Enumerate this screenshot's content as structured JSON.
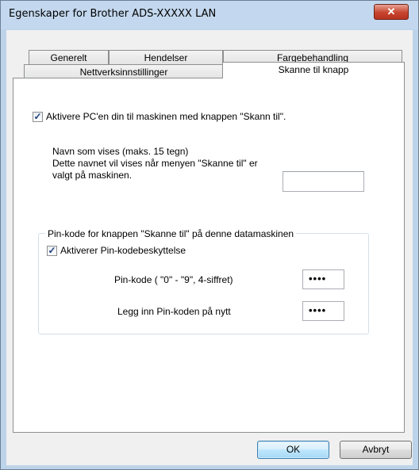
{
  "window": {
    "title": "Egenskaper for Brother ADS-XXXXX LAN",
    "close_glyph": "✕"
  },
  "tabs": {
    "row1": [
      "Generelt",
      "Hendelser",
      "Fargebehandling"
    ],
    "row2": [
      "Nettverksinnstillinger",
      "Skanne til knapp"
    ],
    "active": "Skanne til knapp"
  },
  "panel": {
    "enable_pc_label": "Aktivere PC'en din til maskinen med knappen \"Skann til\".",
    "enable_pc_checked": true,
    "display_name_label_1": "Navn som vises (maks. 15 tegn)",
    "display_name_label_2": "Dette navnet vil vises når menyen \"Skanne til\" er valgt på maskinen.",
    "display_name_value": "",
    "pin_group_label": "Pin-kode for knappen \"Skanne til\" på denne datamaskinen",
    "pin_protect_label": "Aktiverer Pin-kodebeskyttelse",
    "pin_protect_checked": true,
    "pin_label": "Pin-kode ( \"0\" - \"9\", 4-siffret)",
    "pin_value": "••••",
    "pin_confirm_label": "Legg inn Pin-koden på nytt",
    "pin_confirm_value": "••••"
  },
  "buttons": {
    "ok": "OK",
    "cancel": "Avbryt"
  },
  "checkmark_glyph": "✓"
}
